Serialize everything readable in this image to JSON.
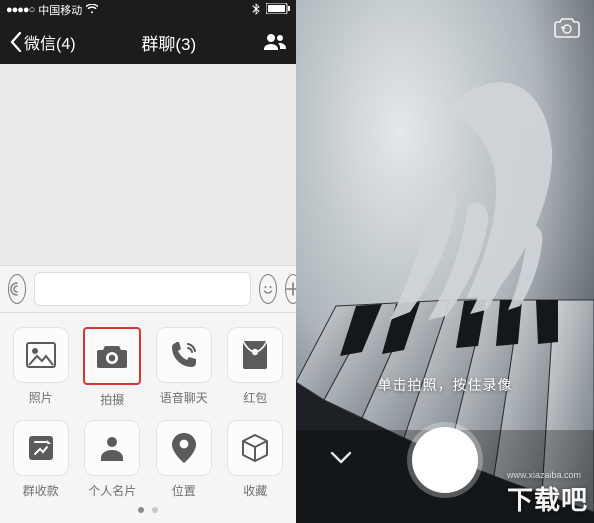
{
  "status": {
    "carrier": "中国移动",
    "signal_dots": "●●●●○"
  },
  "nav": {
    "back_label": "微信(4)",
    "title": "群聊(3)"
  },
  "panel": {
    "items": [
      {
        "label": "照片",
        "icon": "photo-icon"
      },
      {
        "label": "拍摄",
        "icon": "camera-icon",
        "highlight": true
      },
      {
        "label": "语音聊天",
        "icon": "voice-call-icon"
      },
      {
        "label": "红包",
        "icon": "red-packet-icon"
      },
      {
        "label": "群收款",
        "icon": "group-collect-icon"
      },
      {
        "label": "个人名片",
        "icon": "contact-card-icon"
      },
      {
        "label": "位置",
        "icon": "location-icon"
      },
      {
        "label": "收藏",
        "icon": "favorites-icon"
      }
    ],
    "page_count": 2,
    "active_page": 0
  },
  "camera": {
    "hint": "单击拍照，按住录像"
  },
  "watermark": {
    "text": "下载吧",
    "sub": "www.xiazaiba.com"
  }
}
